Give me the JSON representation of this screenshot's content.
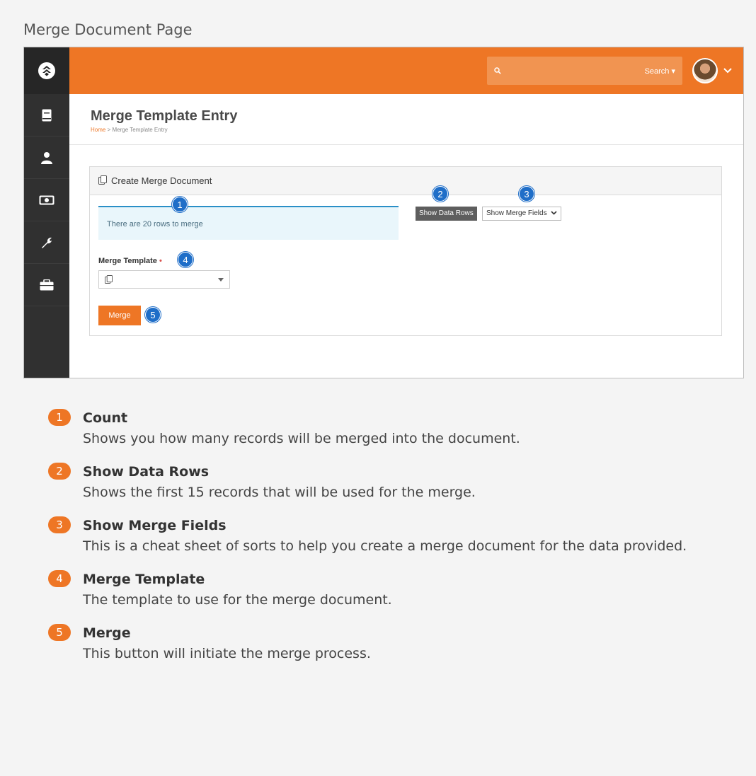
{
  "caption": "Merge Document Page",
  "topbar": {
    "search_placeholder": "",
    "search_type_label": "Search ▾",
    "accent_color": "#ee7625"
  },
  "sidebar": {
    "items": [
      {
        "icon": "book-icon"
      },
      {
        "icon": "person-icon"
      },
      {
        "icon": "money-icon"
      },
      {
        "icon": "wrench-icon"
      },
      {
        "icon": "briefcase-icon"
      }
    ]
  },
  "page": {
    "title": "Merge Template Entry",
    "breadcrumb_home": "Home",
    "breadcrumb_separator": ">",
    "breadcrumb_current": "Merge Template Entry"
  },
  "panel": {
    "title": "Create Merge Document",
    "count_text": "There are 20 rows to merge",
    "show_data_rows_label": "Show Data Rows",
    "show_merge_fields_label": "Show Merge Fields",
    "merge_template_label": "Merge Template",
    "merge_button_label": "Merge"
  },
  "markers": [
    "1",
    "2",
    "3",
    "4",
    "5"
  ],
  "legend": [
    {
      "num": "1",
      "title": "Count",
      "desc": "Shows you how many records will be merged into the document."
    },
    {
      "num": "2",
      "title": "Show Data Rows",
      "desc": "Shows the first 15 records that will be used for the merge."
    },
    {
      "num": "3",
      "title": "Show Merge Fields",
      "desc": "This is a cheat sheet of sorts to help you create a merge document for the data provided."
    },
    {
      "num": "4",
      "title": "Merge Template",
      "desc": "The template to use for the merge document."
    },
    {
      "num": "5",
      "title": "Merge",
      "desc": "This button will initiate the merge process."
    }
  ]
}
